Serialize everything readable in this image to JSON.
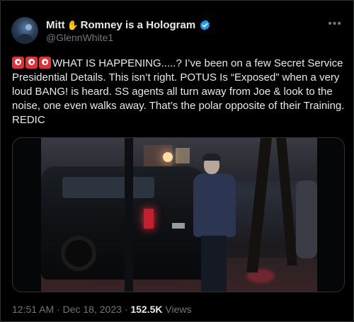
{
  "author": {
    "name_part1": "Mitt",
    "name_emoji_icon": "waving-hand-icon",
    "name_part2": "Romney is a Hologram",
    "verified": true,
    "verified_color": "#1d9bf0",
    "handle": "@GlennWhite1"
  },
  "tweet": {
    "lead_emoji_icon": "police-light-icon",
    "lead_emoji_count": 3,
    "text": "WHAT IS HAPPENING.....? I’ve been on a few Secret Service Presidential Details. This isn’t right. POTUS Is “Exposed” when a very loud BANG! is heard. SS agents all turn away from Joe & look to the noise, one even walks away. That’s the polar opposite of their Training. REDIC"
  },
  "media": {
    "type": "video-still",
    "icon": "night-street-scene-icon"
  },
  "meta": {
    "time": "12:51 AM",
    "separator": "·",
    "date": "Dec 18, 2023",
    "views_count": "152.5K",
    "views_label": "Views"
  },
  "colors": {
    "background": "#000000",
    "text": "#e7e9ea",
    "muted": "#71767b",
    "accent": "#1d9bf0"
  }
}
